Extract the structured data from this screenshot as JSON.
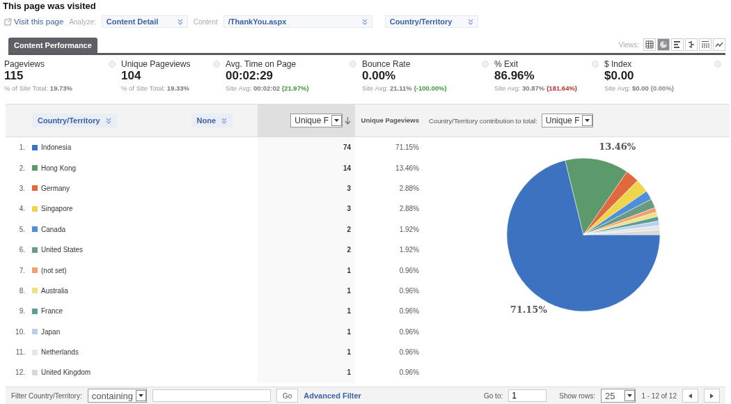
{
  "page_title": "This page was visited",
  "toolbar": {
    "visit_link": "Visit this page",
    "analyze_label": "Analyze:",
    "analyze_value": "Content Detail",
    "content_label": "Content",
    "content_value": "/ThankYou.aspx",
    "dimension_value": "Country/Territory"
  },
  "tabs": [
    {
      "label": "Content Performance",
      "selected": true
    }
  ],
  "views": {
    "label": "Views:",
    "items": [
      {
        "kind": "table",
        "selected": false
      },
      {
        "kind": "pie",
        "selected": true
      },
      {
        "kind": "bars",
        "selected": false
      },
      {
        "kind": "comparison",
        "selected": false
      },
      {
        "kind": "pivot",
        "selected": false
      },
      {
        "kind": "trend",
        "selected": false
      }
    ]
  },
  "metrics": [
    {
      "label": "Pageviews",
      "value": "115",
      "sub_label": "% of Site Total:",
      "sub_value": "19.73%"
    },
    {
      "label": "Unique Pageviews",
      "value": "104",
      "sub_label": "% of Site Total:",
      "sub_value": "19.33%"
    },
    {
      "label": "Avg. Time on Page",
      "value": "00:02:29",
      "sub_label": "Site Avg:",
      "sub_value": "00:02:02",
      "sub_change": "(21.97%)",
      "color": "#3a9a3a"
    },
    {
      "label": "Bounce Rate",
      "value": "0.00%",
      "sub_label": "Site Avg:",
      "sub_value": "21.11%",
      "sub_change": "(-100.00%)",
      "color": "#3a9a3a"
    },
    {
      "label": "% Exit",
      "value": "86.96%",
      "sub_label": "Site Avg:",
      "sub_value": "30.87%",
      "sub_change": "(181.64%)",
      "color": "#c03030"
    },
    {
      "label": "$ Index",
      "value": "$0.00",
      "sub_label": "Site Avg:",
      "sub_value": "$0.00",
      "sub_change": "(0.00%)",
      "color": "#888888"
    }
  ],
  "table": {
    "dimension": "Country/Territory",
    "secondary": "None",
    "metric_select": "Unique F",
    "metric_column": "Unique Pageviews",
    "chart_caption": "Country/Territory contribution to total:",
    "chart_select": "Unique F",
    "rows": [
      {
        "rank": "1.",
        "name": "Indonesia",
        "color": "#3d72c0",
        "value": "74",
        "percent": "71.15%"
      },
      {
        "rank": "2.",
        "name": "Hong Kong",
        "color": "#5c9a6c",
        "value": "14",
        "percent": "13.46%"
      },
      {
        "rank": "3.",
        "name": "Germany",
        "color": "#e2683e",
        "value": "3",
        "percent": "2.88%"
      },
      {
        "rank": "4.",
        "name": "Singapore",
        "color": "#eed54c",
        "value": "3",
        "percent": "2.88%"
      },
      {
        "rank": "5.",
        "name": "Canada",
        "color": "#4f8fda",
        "value": "2",
        "percent": "1.92%"
      },
      {
        "rank": "6.",
        "name": "United States",
        "color": "#6a9b80",
        "value": "2",
        "percent": "1.92%"
      },
      {
        "rank": "7.",
        "name": "(not set)",
        "color": "#f0a070",
        "value": "1",
        "percent": "0.96%"
      },
      {
        "rank": "8.",
        "name": "Australia",
        "color": "#f2e07c",
        "value": "1",
        "percent": "0.96%"
      },
      {
        "rank": "9.",
        "name": "France",
        "color": "#5a9e96",
        "value": "1",
        "percent": "0.96%"
      },
      {
        "rank": "10.",
        "name": "Japan",
        "color": "#b8d0ee",
        "value": "1",
        "percent": "0.96%"
      },
      {
        "rank": "11.",
        "name": "Netherlands",
        "color": "#e6e6e6",
        "value": "1",
        "percent": "0.96%"
      },
      {
        "rank": "12.",
        "name": "United Kingdom",
        "color": "#d8d8d8",
        "value": "1",
        "percent": "0.96%"
      }
    ],
    "chart_data": {
      "type": "pie",
      "values": [
        71.15,
        13.46,
        2.88,
        2.88,
        1.92,
        1.92,
        0.96,
        0.96,
        0.96,
        0.96,
        0.96,
        0.96
      ],
      "value_labels": [
        "71.15%",
        "13.46%",
        null,
        null,
        null,
        null,
        null,
        null,
        null,
        null,
        null,
        null
      ]
    }
  },
  "footer": {
    "filter_label": "Filter Country/Territory:",
    "filter_mode": "containing",
    "go": "Go",
    "advanced": "Advanced Filter",
    "goto_label": "Go to:",
    "goto_value": "1",
    "rows_label": "Show rows:",
    "rows_value": "25",
    "range": "1 - 12 of 12"
  }
}
